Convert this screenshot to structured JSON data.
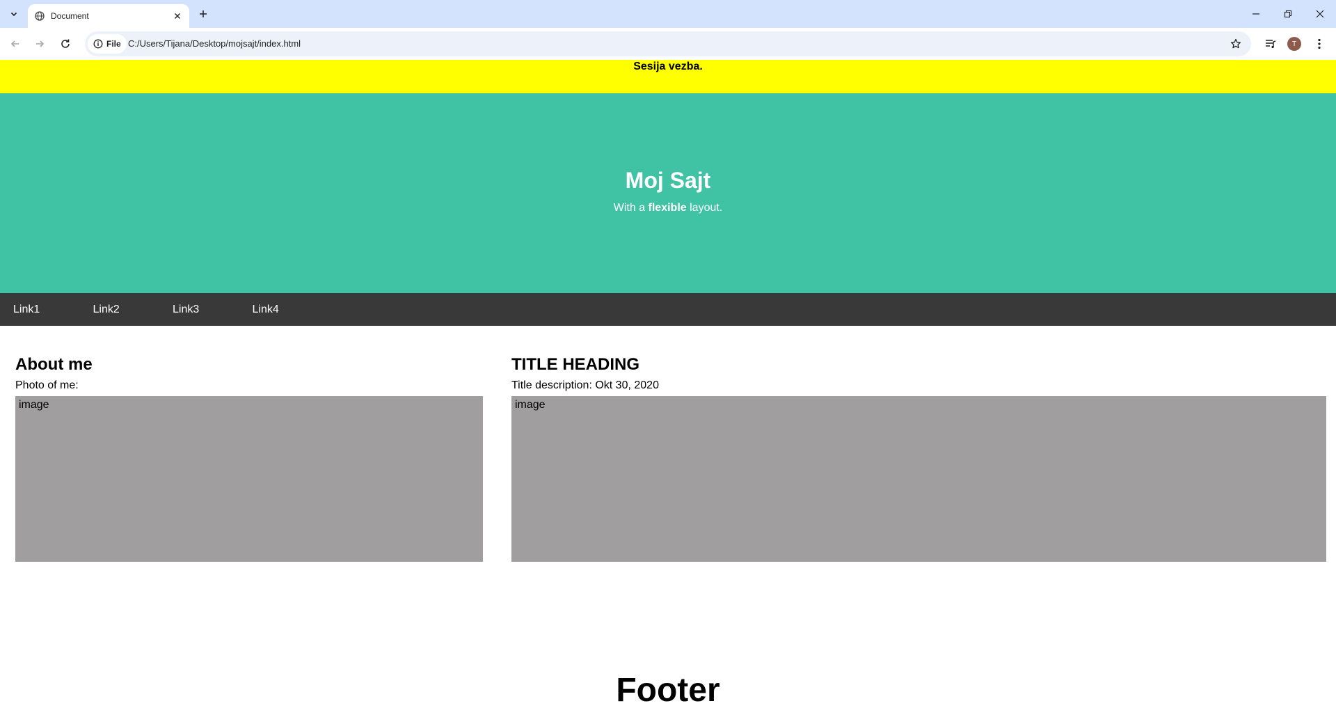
{
  "browser": {
    "tab_title": "Document",
    "site_chip_label": "File",
    "url": "C:/Users/Tijana/Desktop/mojsajt/index.html",
    "avatar_initial": "T"
  },
  "page": {
    "banner": {
      "text": "Sesija vezba.",
      "color": "#ffff00"
    },
    "hero": {
      "title": "Moj Sajt",
      "subtitle_before": "With a ",
      "subtitle_bold": "flexible",
      "subtitle_after": " layout.",
      "color": "#40c2a5"
    },
    "nav": {
      "color": "#393939",
      "links": [
        "Link1",
        "Link2",
        "Link3",
        "Link4"
      ]
    },
    "left_column": {
      "heading": "About me",
      "description": "Photo of me:",
      "image_label": "image"
    },
    "right_column": {
      "heading": "TITLE HEADING",
      "description": "Title description: Okt 30, 2020",
      "image_label": "image"
    },
    "footer": {
      "text": "Footer"
    }
  }
}
